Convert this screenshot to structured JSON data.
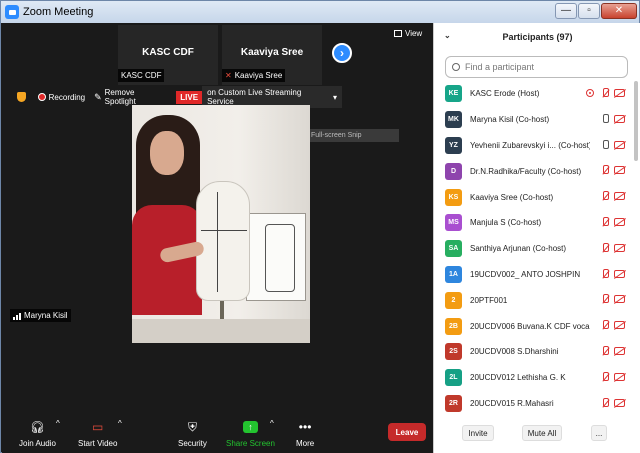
{
  "window": {
    "title": "Zoom Meeting",
    "controls": {
      "minimize": "—",
      "maximize": "▫",
      "close": "✕"
    }
  },
  "thumbnails": [
    {
      "name": "KASC CDF",
      "label": "KASC CDF"
    },
    {
      "name": "Kaaviya Sree",
      "label": "Kaaviya Sree"
    }
  ],
  "view_label": "View",
  "status": {
    "recording": "Recording",
    "remove_spotlight": "Remove Spotlight",
    "live": "LIVE",
    "stream": "on Custom Live Streaming Service",
    "fullscreen_snip": "Full-screen Snip"
  },
  "speaker_name": "Maryna Kisil",
  "toolbar": {
    "join_audio": "Join Audio",
    "start_video": "Start Video",
    "security": "Security",
    "share_screen": "Share Screen",
    "more": "More",
    "leave": "Leave"
  },
  "participants": {
    "title": "Participants (97)",
    "search_placeholder": "Find a participant",
    "list": [
      {
        "initials": "KE",
        "name": "KASC Erode (Host)",
        "color": "#17a589",
        "rec": true,
        "mic": "muted",
        "cam": true
      },
      {
        "initials": "MK",
        "name": "Maryna Kisil (Co-host)",
        "color": "#2c3e50",
        "rec": false,
        "mic": "on",
        "cam": true
      },
      {
        "initials": "YZ",
        "name": "Yevhenii Zubarevskyi i... (Co-host)",
        "color": "#2c3e50",
        "rec": false,
        "mic": "on",
        "cam": true
      },
      {
        "initials": "D",
        "name": "Dr.N.Radhika/Faculty (Co-host)",
        "color": "#8e44ad",
        "rec": false,
        "mic": "muted",
        "cam": true
      },
      {
        "initials": "KS",
        "name": "Kaaviya Sree (Co-host)",
        "color": "#f39c12",
        "rec": false,
        "mic": "muted",
        "cam": true
      },
      {
        "initials": "MS",
        "name": "Manjula S (Co-host)",
        "color": "#a94fd0",
        "rec": false,
        "mic": "muted",
        "cam": true
      },
      {
        "initials": "SA",
        "name": "Santhiya Arjunan (Co-host)",
        "color": "#27ae60",
        "rec": false,
        "mic": "muted",
        "cam": true
      },
      {
        "initials": "1A",
        "name": "19UCDV002_ ANTO JOSHPIN",
        "color": "#2e86de",
        "rec": false,
        "mic": "muted",
        "cam": true
      },
      {
        "initials": "2",
        "name": "20PTF001",
        "color": "#f39c12",
        "rec": false,
        "mic": "muted",
        "cam": true
      },
      {
        "initials": "2B",
        "name": "20UCDV006 Buvana.K CDF voca...",
        "color": "#f39c12",
        "rec": false,
        "mic": "muted",
        "cam": true
      },
      {
        "initials": "2S",
        "name": "20UCDV008 S.Dharshini",
        "color": "#c0392b",
        "rec": false,
        "mic": "muted",
        "cam": true
      },
      {
        "initials": "2L",
        "name": "20UCDV012 Lethisha G. K",
        "color": "#16a085",
        "rec": false,
        "mic": "muted",
        "cam": true
      },
      {
        "initials": "2R",
        "name": "20UCDV015 R.Mahasri",
        "color": "#c0392b",
        "rec": false,
        "mic": "muted",
        "cam": true
      }
    ],
    "invite": "Invite",
    "mute_all": "Mute All",
    "more": "..."
  }
}
